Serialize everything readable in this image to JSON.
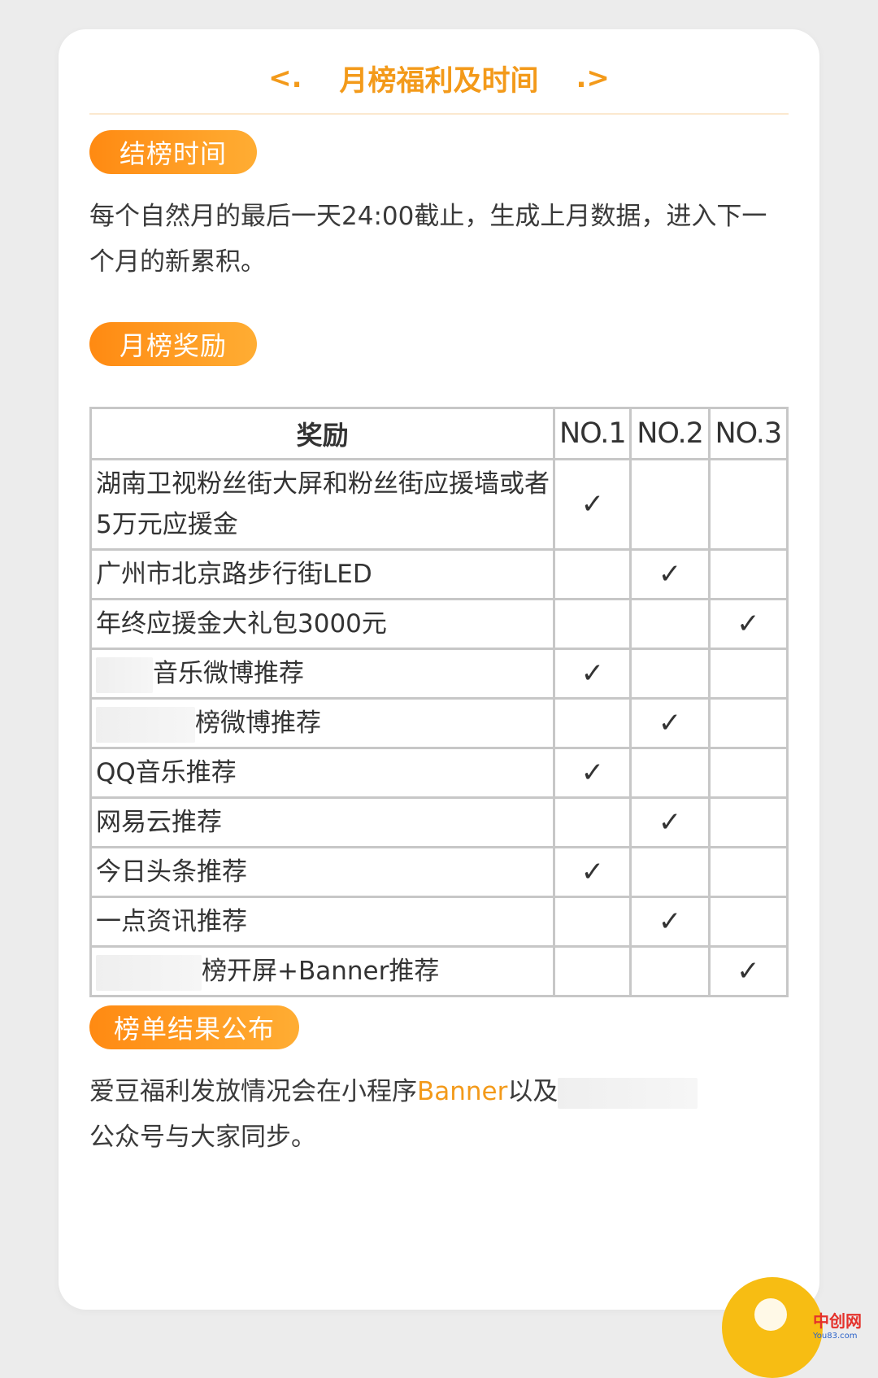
{
  "header": {
    "title": "月榜福利及时间",
    "prev_label": "<.",
    "next_label": ".>"
  },
  "sections": {
    "closing": {
      "pill": "结榜时间",
      "text": "每个自然月的最后一天24:00截止，生成上月数据，进入下一个月的新累积。"
    },
    "rewards": {
      "pill": "月榜奖励",
      "table": {
        "headers": [
          "奖励",
          "NO.1",
          "NO.2",
          "NO.3"
        ],
        "rows": [
          {
            "name": "湖南卫视粉丝街大屏和粉丝街应援墙或者5万元应援金",
            "mark": "✓",
            "rank": 1
          },
          {
            "name": "广州市北京路步行街LED",
            "mark": "✓",
            "rank": 2
          },
          {
            "name": "年终应援金大礼包3000元",
            "mark": "✓",
            "rank": 3
          },
          {
            "name": "音乐微博推荐",
            "mark": "✓",
            "rank": 1
          },
          {
            "name": "榜微博推荐",
            "mark": "✓",
            "rank": 2
          },
          {
            "name": "QQ音乐推荐",
            "mark": "✓",
            "rank": 1
          },
          {
            "name": "网易云推荐",
            "mark": "✓",
            "rank": 2
          },
          {
            "name": "今日头条推荐",
            "mark": "✓",
            "rank": 1
          },
          {
            "name": "一点资讯推荐",
            "mark": "✓",
            "rank": 2
          },
          {
            "name": "榜开屏+Banner推荐",
            "mark": "✓",
            "rank": 3
          }
        ]
      }
    },
    "results": {
      "pill": "榜单结果公布",
      "text_a": "爱豆福利发放情况会在小程序",
      "text_accent": "Banner",
      "text_b": "以及",
      "text_c": "公众号与大家同步。"
    }
  },
  "watermark": {
    "main": "中创网",
    "sub": "You83.com"
  },
  "colors": {
    "accent": "#f39a1a",
    "pill_start": "#ff8a12",
    "pill_end": "#ffad33",
    "bubble": "#f7bd13"
  }
}
